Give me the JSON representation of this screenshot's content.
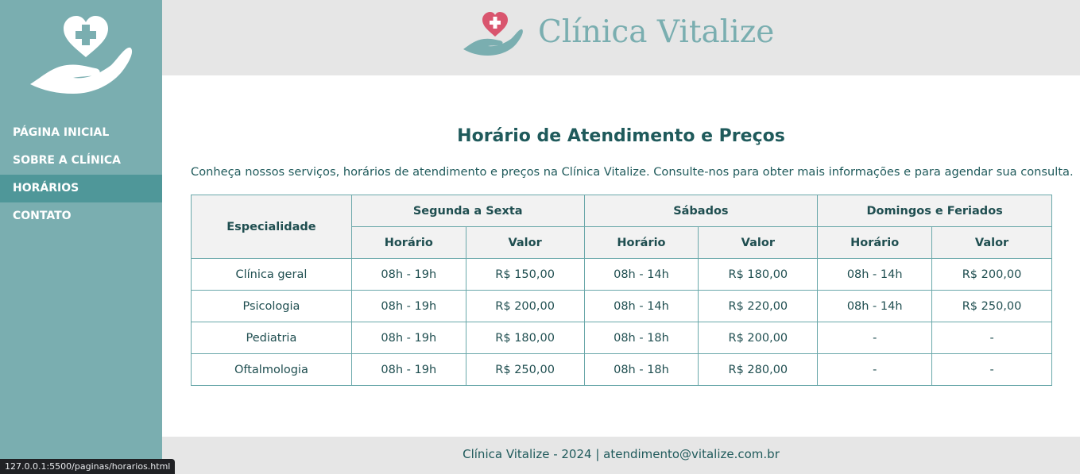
{
  "colors": {
    "accent": "#7aaeb0",
    "accent_dark": "#4f9799",
    "heart": "#d9556e",
    "text": "#1f5a5b"
  },
  "brand": {
    "name": "Clínica Vitalize",
    "logo_icon": "heart-hand-icon"
  },
  "sidebar": {
    "logo_icon": "heart-hand-icon",
    "items": [
      {
        "label": "PÁGINA INICIAL",
        "active": false
      },
      {
        "label": "SOBRE A CLÍNICA",
        "active": false
      },
      {
        "label": "HORÁRIOS",
        "active": true
      },
      {
        "label": "CONTATO",
        "active": false
      }
    ]
  },
  "main": {
    "title": "Horário de Atendimento e Preços",
    "intro": "Conheça nossos serviços, horários de atendimento e preços na Clínica Vitalize. Consulte-nos para obter mais informações e para agendar sua consulta."
  },
  "table": {
    "specialty_header": "Especialidade",
    "groups": [
      "Segunda a Sexta",
      "Sábados",
      "Domingos e Feriados"
    ],
    "subheaders": [
      "Horário",
      "Valor"
    ],
    "rows": [
      [
        "Clínica geral",
        "08h - 19h",
        "R$ 150,00",
        "08h - 14h",
        "R$ 180,00",
        "08h - 14h",
        "R$ 200,00"
      ],
      [
        "Psicologia",
        "08h - 19h",
        "R$ 200,00",
        "08h - 14h",
        "R$ 220,00",
        "08h - 14h",
        "R$ 250,00"
      ],
      [
        "Pediatria",
        "08h - 19h",
        "R$ 180,00",
        "08h - 18h",
        "R$ 200,00",
        "-",
        "-"
      ],
      [
        "Oftalmologia",
        "08h - 19h",
        "R$ 250,00",
        "08h - 18h",
        "R$ 280,00",
        "-",
        "-"
      ]
    ]
  },
  "footer": {
    "text": "Clínica Vitalize - 2024 | atendimento@vitalize.com.br"
  },
  "status_bar": {
    "url": "127.0.0.1:5500/paginas/horarios.html"
  }
}
